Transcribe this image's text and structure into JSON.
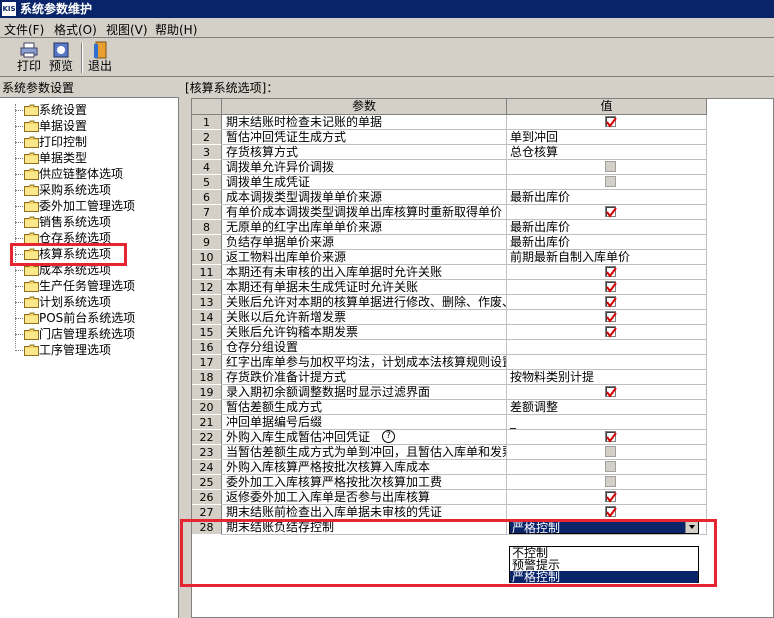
{
  "window": {
    "title": "系统参数维护",
    "logo_text": "KIS"
  },
  "menu": [
    "文件(F)",
    "格式(O)",
    "视图(V)",
    "帮助(H)"
  ],
  "toolbar": {
    "print": "打印",
    "preview": "预览",
    "exit": "退出"
  },
  "left": {
    "header": "系统参数设置",
    "items": [
      "系统设置",
      "单据设置",
      "打印控制",
      "单据类型",
      "供应链整体选项",
      "采购系统选项",
      "委外加工管理选项",
      "销售系统选项",
      "仓存系统选项",
      "核算系统选项",
      "成本系统选项",
      "生产任务管理选项",
      "计划系统选项",
      "POS前台系统选项",
      "门店管理系统选项",
      "工序管理选项"
    ],
    "selected": "核算系统选项"
  },
  "right": {
    "header": "[核算系统选项]：",
    "col_param": "参数",
    "col_value": "值"
  },
  "rows": [
    {
      "n": "1",
      "p": "期末结账时检查未记账的单据",
      "v": "",
      "cb": "checked"
    },
    {
      "n": "2",
      "p": "暂估冲回凭证生成方式",
      "v": "单到冲回",
      "cb": ""
    },
    {
      "n": "3",
      "p": "存货核算方式",
      "v": "总仓核算",
      "cb": ""
    },
    {
      "n": "4",
      "p": "调拨单允许异价调拨",
      "v": "",
      "cb": "off"
    },
    {
      "n": "5",
      "p": "调拨单生成凭证",
      "v": "",
      "cb": "off"
    },
    {
      "n": "6",
      "p": "成本调拨类型调拨单单价来源",
      "v": "最新出库价",
      "cb": ""
    },
    {
      "n": "7",
      "p": "有单价成本调拨类型调拨单出库核算时重新取得单价",
      "v": "",
      "cb": "checked"
    },
    {
      "n": "8",
      "p": "无原单的红字出库单单价来源",
      "v": "最新出库价",
      "cb": ""
    },
    {
      "n": "9",
      "p": "负结存单据单价来源",
      "v": "最新出库价",
      "cb": ""
    },
    {
      "n": "10",
      "p": "返工物料出库单价来源",
      "v": "前期最新自制入库单价",
      "cb": ""
    },
    {
      "n": "11",
      "p": "本期还有未审核的出入库单据时允许关账",
      "v": "",
      "cb": "checked"
    },
    {
      "n": "12",
      "p": "本期还有单据未生成凭证时允许关账",
      "v": "",
      "cb": "checked"
    },
    {
      "n": "13",
      "p": "关账后允许对本期的核算单据进行修改、删除、作废、",
      "v": "",
      "cb": "checked"
    },
    {
      "n": "14",
      "p": "关账以后允许新增发票",
      "v": "",
      "cb": "checked"
    },
    {
      "n": "15",
      "p": "关账后允许钩稽本期发票",
      "v": "",
      "cb": "checked"
    },
    {
      "n": "16",
      "p": "仓存分组设置",
      "v": "",
      "cb": ""
    },
    {
      "n": "17",
      "p": "红字出库单参与加权平均法，计划成本法核算规则设置",
      "v": "",
      "cb": ""
    },
    {
      "n": "18",
      "p": "存货跌价准备计提方式",
      "v": "按物料类别计提",
      "cb": ""
    },
    {
      "n": "19",
      "p": "录入期初余额调整数据时显示过滤界面",
      "v": "",
      "cb": "checked"
    },
    {
      "n": "20",
      "p": "暂估差额生成方式",
      "v": "差额调整",
      "cb": ""
    },
    {
      "n": "21",
      "p": "冲回单据编号后缀",
      "v": "_",
      "cb": ""
    },
    {
      "n": "22",
      "p": "外购入库生成暂估冲回凭证",
      "v": "",
      "cb": "checked",
      "help": "?"
    },
    {
      "n": "23",
      "p": "当暂估差额生成方式为单到冲回，且暂估入库单和发票",
      "v": "",
      "cb": "off"
    },
    {
      "n": "24",
      "p": "外购入库核算严格按批次核算入库成本",
      "v": "",
      "cb": "off"
    },
    {
      "n": "25",
      "p": "委外加工入库核算严格按批次核算加工费",
      "v": "",
      "cb": "off"
    },
    {
      "n": "26",
      "p": "返修委外加工入库单是否参与出库核算",
      "v": "",
      "cb": "checked"
    },
    {
      "n": "27",
      "p": "期末结账前检查出入库单据未审核的凭证",
      "v": "",
      "cb": "checked"
    },
    {
      "n": "28",
      "p": "期末结账负结存控制",
      "v": "",
      "cb": ""
    }
  ],
  "combo": {
    "value": "严格控制",
    "options": [
      "不控制",
      "预警提示",
      "严格控制"
    ],
    "selected": "严格控制"
  },
  "colors": {
    "highlight_red": "#e5252f",
    "selection": "#0a246a",
    "check_red": "#d40000"
  }
}
